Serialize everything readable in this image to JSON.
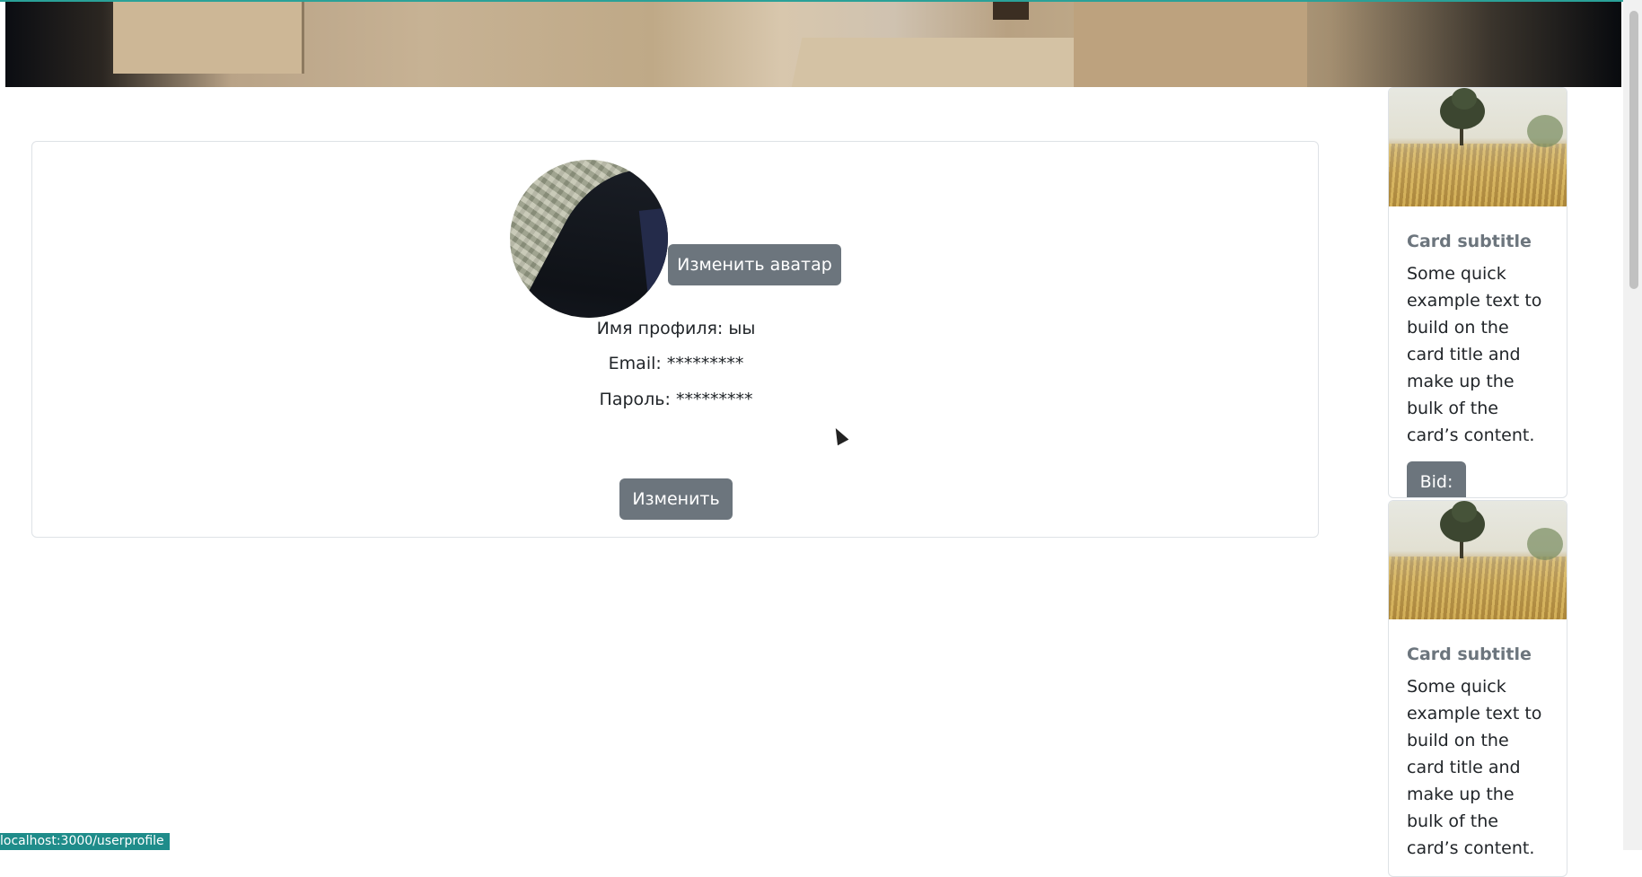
{
  "profile": {
    "change_avatar_label": "Изменить аватар",
    "name_line": "Имя профиля: ыы",
    "email_line": "Email: *********",
    "password_line": "Пароль: *********",
    "edit_label": "Изменить"
  },
  "side_cards": [
    {
      "subtitle": "Card subtitle",
      "text": "Some quick example text to build on the card title and make up the bulk of the card’s content.",
      "button_label": "Bid:"
    },
    {
      "subtitle": "Card subtitle",
      "text": "Some quick example text to build on the card title and make up the bulk of the card’s content."
    }
  ],
  "status_bar": {
    "url": "localhost:3000/userprofile"
  }
}
